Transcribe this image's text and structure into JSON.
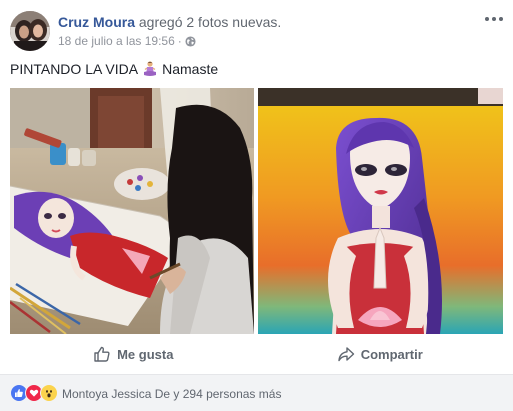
{
  "post": {
    "author_name": "Cruz Moura",
    "action_text": "agregó 2 fotos nuevas.",
    "timestamp": "18 de julio a las 19:56",
    "dot": "·",
    "text_before": "PINTANDO LA VIDA",
    "text_after": "Namaste",
    "privacy_icon": "globe-icon",
    "emoji_icon": "meditation-emoji-icon"
  },
  "photos": [
    {
      "name": "photo-girl-painting-canvas"
    },
    {
      "name": "photo-finished-painting-woman-namaste"
    }
  ],
  "actions": {
    "like_label": "Me gusta",
    "share_label": "Compartir"
  },
  "reactions": {
    "icons": [
      "like-reaction-icon",
      "love-reaction-icon",
      "wow-reaction-icon"
    ],
    "summary": "Montoya Jessica De y 294 personas más"
  },
  "colors": {
    "link": "#365899",
    "muted": "#616770",
    "like_blue": "#4a76f2",
    "love_red": "#f0284a",
    "wow_yellow": "#fbd34d"
  }
}
